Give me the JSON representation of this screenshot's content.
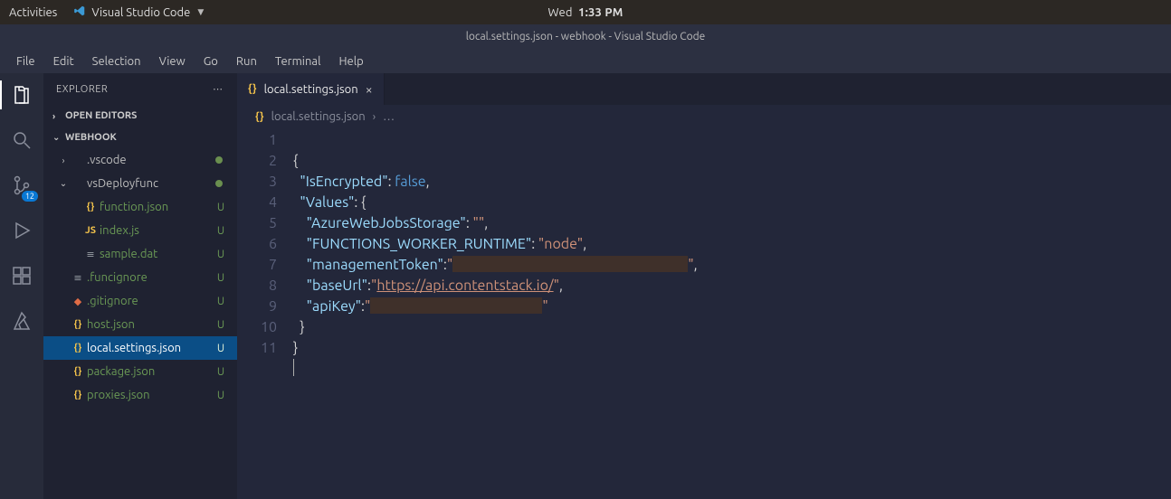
{
  "gnome": {
    "activities": "Activities",
    "app_name": "Visual Studio Code",
    "clock_day": "Wed",
    "clock_time": "1:33 PM"
  },
  "window_title": "local.settings.json - webhook - Visual Studio Code",
  "menu": [
    "File",
    "Edit",
    "Selection",
    "View",
    "Go",
    "Run",
    "Terminal",
    "Help"
  ],
  "activity_bar": {
    "items": [
      {
        "name": "explorer",
        "active": true
      },
      {
        "name": "search",
        "active": false
      },
      {
        "name": "source-control",
        "active": false,
        "badge": "12"
      },
      {
        "name": "run-debug",
        "active": false
      },
      {
        "name": "extensions",
        "active": false
      },
      {
        "name": "azure",
        "active": false
      }
    ]
  },
  "sidebar": {
    "title": "EXPLORER",
    "open_editors": "OPEN EDITORS",
    "workspace": "WEBHOOK",
    "tree": [
      {
        "indent": 0,
        "kind": "folder",
        "icon": "chev",
        "open": false,
        "name": ".vscode",
        "dot": true
      },
      {
        "indent": 0,
        "kind": "folder",
        "icon": "chev",
        "open": true,
        "name": "vsDeployfunc",
        "dot": true
      },
      {
        "indent": 1,
        "kind": "file",
        "icon_class": "brace",
        "icon": "{}",
        "name": "function.json",
        "status": "U"
      },
      {
        "indent": 1,
        "kind": "file",
        "icon_class": "js",
        "icon": "JS",
        "name": "index.js",
        "status": "U"
      },
      {
        "indent": 1,
        "kind": "file",
        "icon_class": "lines",
        "icon": "≡",
        "name": "sample.dat",
        "status": "U"
      },
      {
        "indent": 0,
        "kind": "file",
        "icon_class": "lines",
        "icon": "≡",
        "name": ".funcignore",
        "status": "U"
      },
      {
        "indent": 0,
        "kind": "file",
        "icon_class": "gitign",
        "icon": "◆",
        "name": ".gitignore",
        "status": "U"
      },
      {
        "indent": 0,
        "kind": "file",
        "icon_class": "brace",
        "icon": "{}",
        "name": "host.json",
        "status": "U"
      },
      {
        "indent": 0,
        "kind": "file",
        "icon_class": "brace",
        "icon": "{}",
        "name": "local.settings.json",
        "status": "U",
        "active": true
      },
      {
        "indent": 0,
        "kind": "file",
        "icon_class": "brace",
        "icon": "{}",
        "name": "package.json",
        "status": "U"
      },
      {
        "indent": 0,
        "kind": "file",
        "icon_class": "brace",
        "icon": "{}",
        "name": "proxies.json",
        "status": "U"
      }
    ]
  },
  "tab": {
    "icon": "{}",
    "label": "local.settings.json"
  },
  "breadcrumb": {
    "icon": "{}",
    "label": "local.settings.json",
    "more": "…"
  },
  "code": {
    "lines": [
      "1",
      "2",
      "3",
      "4",
      "5",
      "6",
      "7",
      "8",
      "9",
      "10",
      "11"
    ],
    "tokens": {
      "l1": "{",
      "l2_key": "\"IsEncrypted\"",
      "l2_val": "false",
      "l3_key": "\"Values\"",
      "l4_key": "\"AzureWebJobsStorage\"",
      "l4_val": "\"\"",
      "l5_key": "\"FUNCTIONS_WORKER_RUNTIME\"",
      "l5_val": "\"node\"",
      "l6_key": "\"managementToken\"",
      "l6_q": "\"",
      "l6_close": "\"",
      "l7_key": "\"baseUrl\"",
      "l7_q": "\"",
      "l7_url": "https://api.contentstack.io/",
      "l7_close": "\"",
      "l8_key": "\"apiKey\"",
      "l8_q": "\"",
      "l8_close": "\"",
      "l9": "}",
      "l10": "}"
    }
  }
}
